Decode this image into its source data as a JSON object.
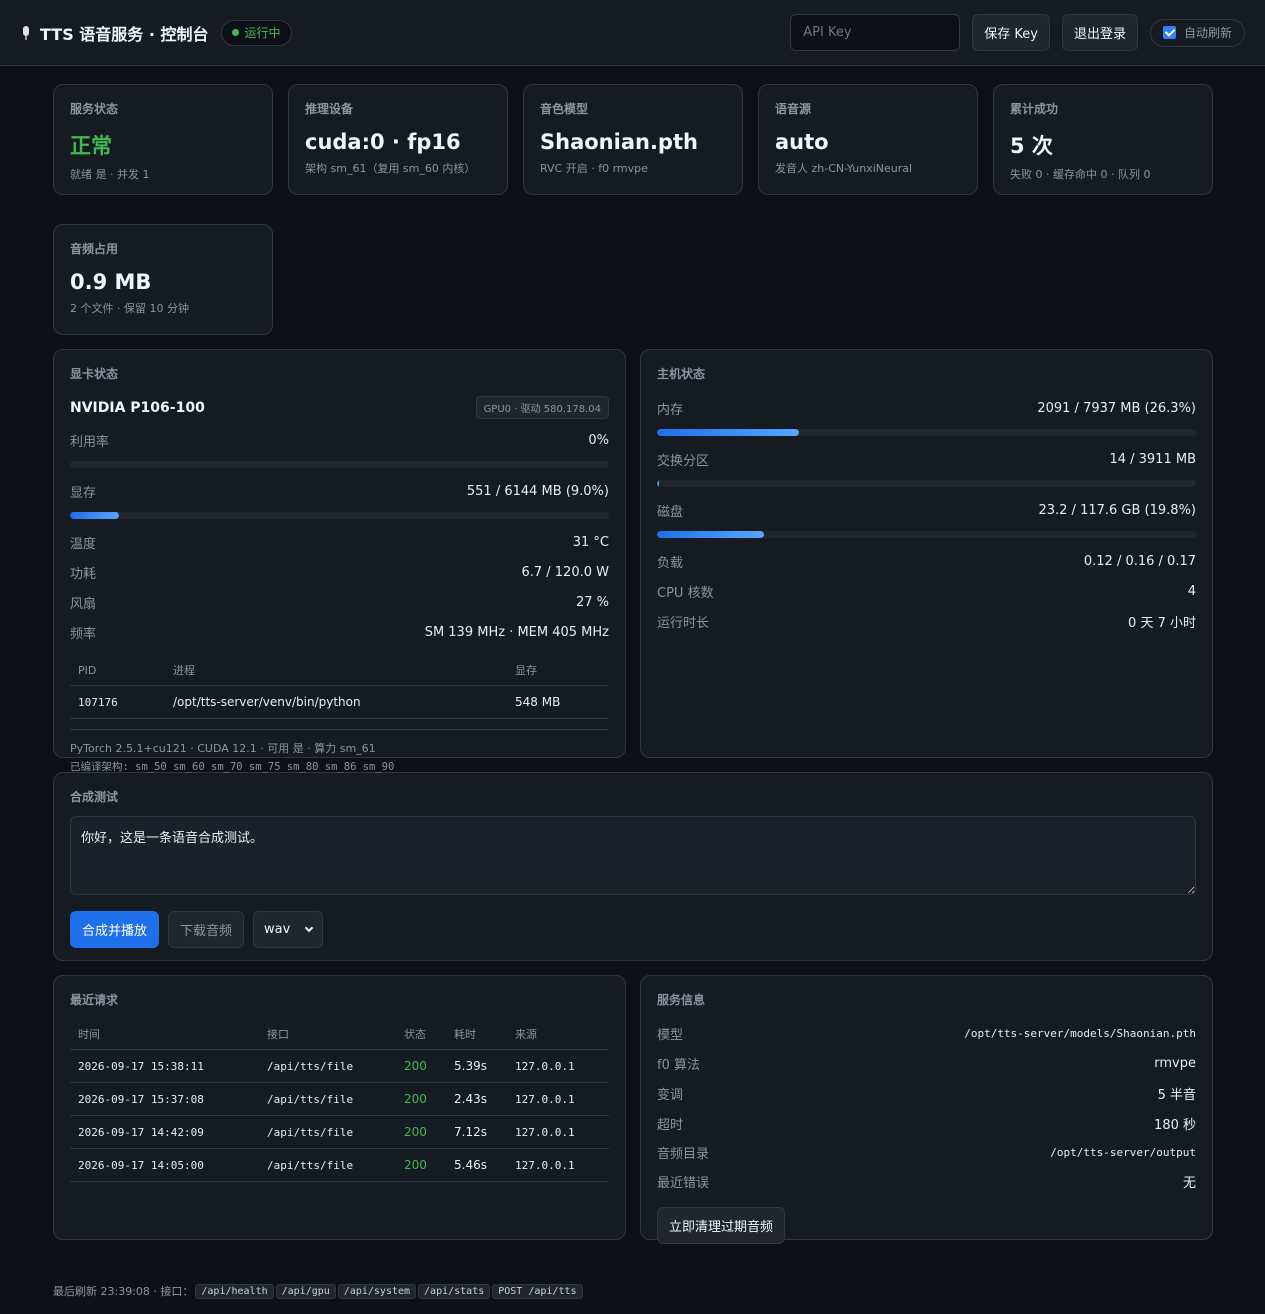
{
  "header": {
    "title": "TTS 语音服务 · 控制台",
    "status": "运行中",
    "api_key_placeholder": "API Key",
    "save_key": "保存 Key",
    "logout": "退出登录",
    "auto_refresh": "自动刷新",
    "auto_refresh_checked": true
  },
  "stats": [
    {
      "label": "服务状态",
      "value": "正常",
      "sub": "就绪 是 · 并发 1"
    },
    {
      "label": "推理设备",
      "value": "cuda:0 · fp16",
      "sub": "架构 sm_61（复用 sm_60 内核）"
    },
    {
      "label": "音色模型",
      "value": "Shaonian.pth",
      "sub": "RVC 开启 · f0 rmvpe"
    },
    {
      "label": "语音源",
      "value": "auto",
      "sub": "发音人 zh-CN-YunxiNeural"
    },
    {
      "label": "累计成功",
      "value": "5 次",
      "sub": "失败 0 · 缓存命中 0 · 队列 0"
    },
    {
      "label": "音频占用",
      "value": "0.9 MB",
      "sub": "2 个文件 · 保留 10 分钟"
    }
  ],
  "gpu": {
    "title": "显卡状态",
    "name": "NVIDIA P106-100",
    "tag": "GPU0 · 驱动 580.178.04",
    "util_label": "利用率",
    "util_value": "0%",
    "util_fraction": 0.0,
    "mem_label": "显存",
    "mem_value": "551 / 6144 MB (9.0%)",
    "mem_fraction": 0.09,
    "temp_label": "温度",
    "temp_value": "31 °C",
    "power_label": "功耗",
    "power_value": "6.7 / 120.0 W",
    "fan_label": "风扇",
    "fan_value": "27 %",
    "clock_label": "频率",
    "clock_value": "SM 139 MHz · MEM 405 MHz",
    "proc_headers": [
      "PID",
      "进程",
      "显存"
    ],
    "processes": [
      {
        "pid": "107176",
        "name": "/opt/tts-server/venv/bin/python",
        "mem": "548 MB"
      }
    ],
    "torch_line": "PyTorch 2.5.1+cu121 · CUDA 12.1 · 可用 是 · 算力 sm_61",
    "arch_line": "已编译架构: sm_50 sm_60 sm_70 sm_75 sm_80 sm_86 sm_90"
  },
  "host": {
    "title": "主机状态",
    "mem_label": "内存",
    "mem_value": "2091 / 7937 MB (26.3%)",
    "mem_fraction": 0.263,
    "swap_label": "交换分区",
    "swap_value": "14 / 3911 MB",
    "swap_fraction": 0.0036,
    "disk_label": "磁盘",
    "disk_value": "23.2 / 117.6 GB (19.8%)",
    "disk_fraction": 0.198,
    "load_label": "负载",
    "load_value": "0.12 / 0.16 / 0.17",
    "cpu_label": "CPU 核数",
    "cpu_value": "4",
    "uptime_label": "运行时长",
    "uptime_value": "0 天 7 小时"
  },
  "synth": {
    "title": "合成测试",
    "text": "你好，这是一条语音合成测试。",
    "play_button": "合成并播放",
    "download_button": "下载音频",
    "format": "wav"
  },
  "requests": {
    "title": "最近请求",
    "headers": [
      "时间",
      "接口",
      "状态",
      "耗时",
      "来源"
    ],
    "rows": [
      {
        "time": "2026-09-17 15:38:11",
        "api": "/api/tts/file",
        "status": "200",
        "cost": "5.39s",
        "src": "127.0.0.1"
      },
      {
        "time": "2026-09-17 15:37:08",
        "api": "/api/tts/file",
        "status": "200",
        "cost": "2.43s",
        "src": "127.0.0.1"
      },
      {
        "time": "2026-09-17 14:42:09",
        "api": "/api/tts/file",
        "status": "200",
        "cost": "7.12s",
        "src": "127.0.0.1"
      },
      {
        "time": "2026-09-17 14:05:00",
        "api": "/api/tts/file",
        "status": "200",
        "cost": "5.46s",
        "src": "127.0.0.1"
      }
    ]
  },
  "service": {
    "title": "服务信息",
    "items": [
      {
        "k": "模型",
        "v": "/opt/tts-server/models/Shaonian.pth",
        "mono": true
      },
      {
        "k": "f0 算法",
        "v": "rmvpe",
        "mono": false
      },
      {
        "k": "变调",
        "v": "5 半音",
        "mono": false
      },
      {
        "k": "超时",
        "v": "180 秒",
        "mono": false
      },
      {
        "k": "音频目录",
        "v": "/opt/tts-server/output",
        "mono": true
      },
      {
        "k": "最近错误",
        "v": "无",
        "mono": false
      }
    ],
    "clean_button": "立即清理过期音频"
  },
  "footer": {
    "prefix": "最后刷新 23:39:08 · 接口：",
    "endpoints": [
      "/api/health",
      "/api/gpu",
      "/api/system",
      "/api/stats",
      "POST /api/tts"
    ]
  }
}
